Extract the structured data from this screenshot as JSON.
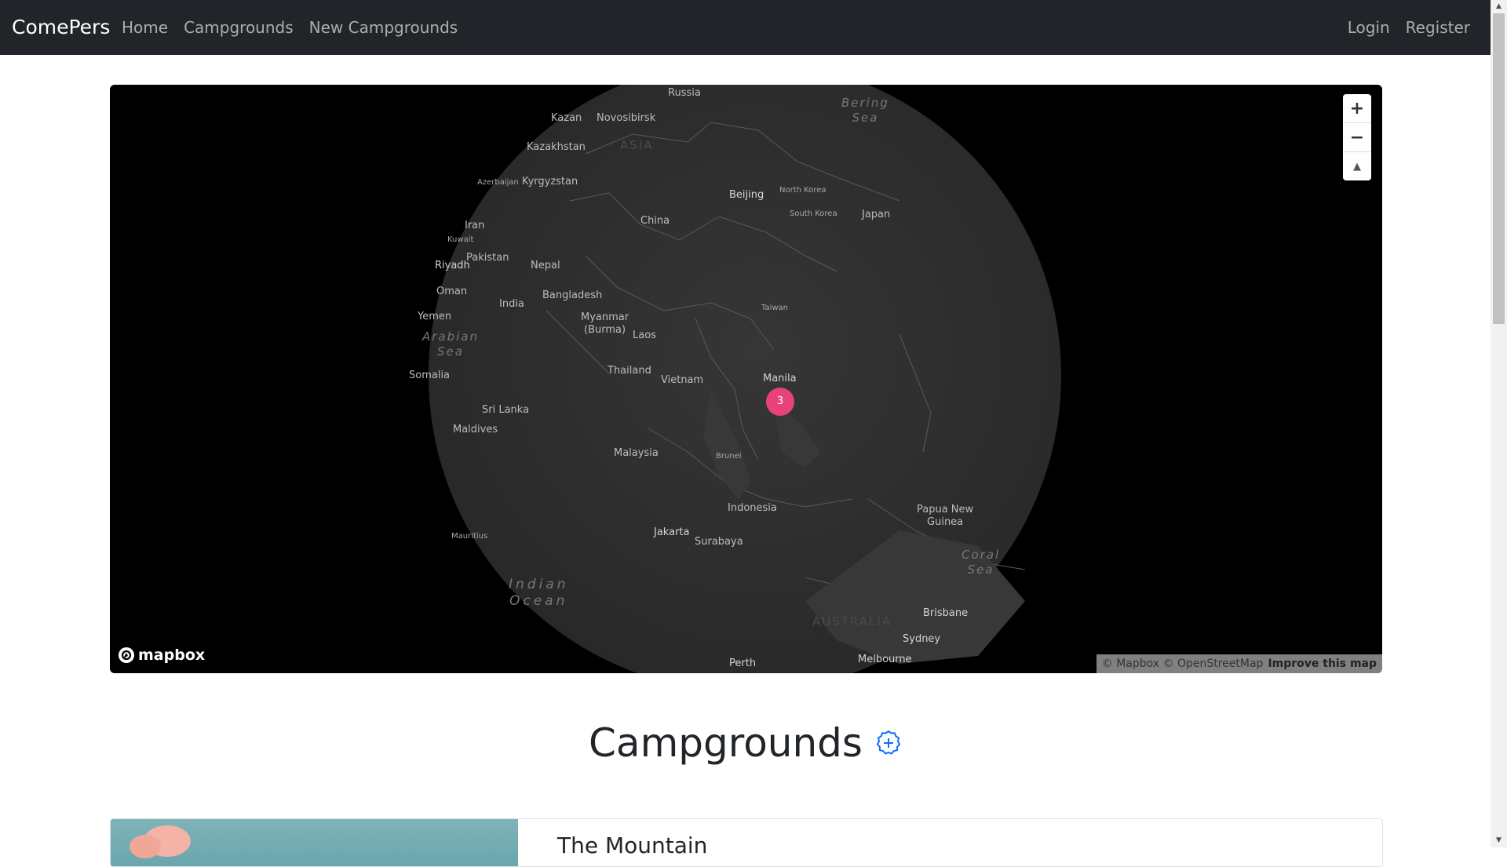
{
  "navbar": {
    "brand": "ComePers",
    "links": [
      "Home",
      "Campgrounds",
      "New Campgrounds"
    ],
    "right_links": [
      "Login",
      "Register"
    ]
  },
  "map": {
    "labels": {
      "russia": "Russia",
      "bering_sea": "Bering\nSea",
      "kazan": "Kazan",
      "novosibirsk": "Novosibirsk",
      "kazakhstan": "Kazakhstan",
      "asia": "ASIA",
      "azerbaijan": "Azerbaijan",
      "kyrgyzstan": "Kyrgyzstan",
      "beijing": "Beijing",
      "north_korea": "North Korea",
      "south_korea": "South Korea",
      "japan": "Japan",
      "iran": "Iran",
      "kuwait": "Kuwait",
      "china": "China",
      "pakistan": "Pakistan",
      "riyadh": "Riyadh",
      "nepal": "Nepal",
      "oman": "Oman",
      "bangladesh": "Bangladesh",
      "india": "India",
      "taiwan": "Taiwan",
      "yemen": "Yemen",
      "myanmar": "Myanmar\n(Burma)",
      "arabian_sea": "Arabian\nSea",
      "laos": "Laos",
      "thailand": "Thailand",
      "somalia": "Somalia",
      "manila": "Manila",
      "vietnam": "Vietnam",
      "sri_lanka": "Sri Lanka",
      "maldives": "Maldives",
      "malaysia": "Malaysia",
      "brunei": "Brunei",
      "indonesia": "Indonesia",
      "papua": "Papua New\nGuinea",
      "jakarta": "Jakarta",
      "surabaya": "Surabaya",
      "mauritius": "Mauritius",
      "coral_sea": "Coral\nSea",
      "indian_ocean": "Indian\nOcean",
      "australia": "AUSTRALIA",
      "brisbane": "Brisbane",
      "sydney": "Sydney",
      "perth": "Perth",
      "melbourne": "Melbourne"
    },
    "cluster_count": "3",
    "controls": {
      "zoom_in": "+",
      "zoom_out": "−",
      "compass": "▲"
    },
    "logo": "mapbox",
    "attribution": "© Mapbox © OpenStreetMap",
    "improve": "Improve this map",
    "colors": {
      "cluster": "#e8427c",
      "ocean": "#000000",
      "land": "#2e2e2e"
    }
  },
  "page": {
    "title": "Campgrounds",
    "add_icon": "plus-circle-icon",
    "accent": "#0d6efd"
  },
  "campgrounds": [
    {
      "title": "The Mountain"
    }
  ]
}
